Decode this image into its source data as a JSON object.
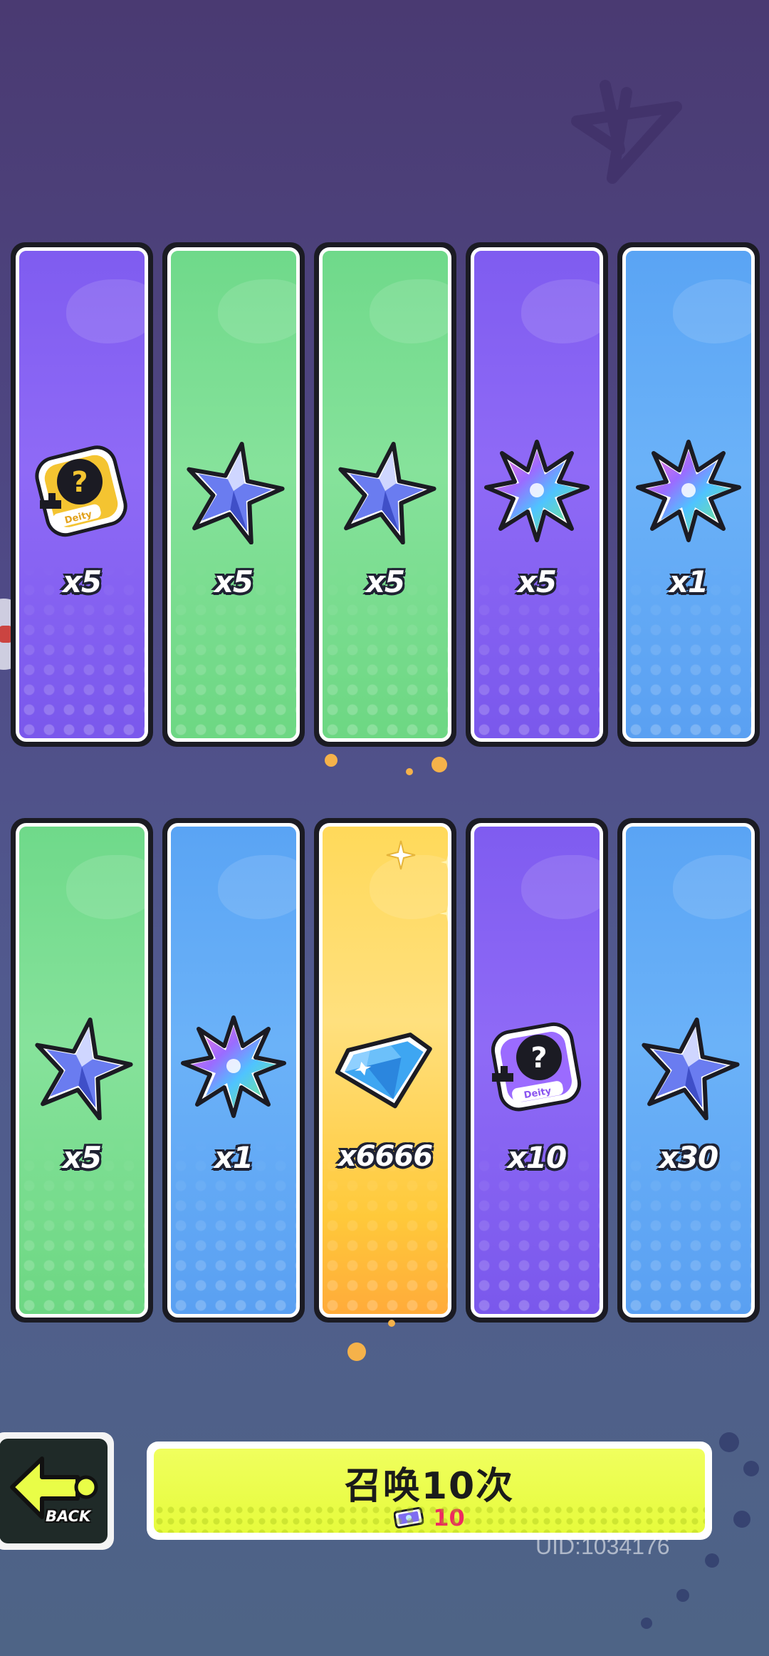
{
  "rows": [
    [
      {
        "theme": "purple",
        "icon": "deity-mystery-card-gold-icon",
        "qty": "x5"
      },
      {
        "theme": "green",
        "icon": "blue-star-shard-icon",
        "qty": "x5"
      },
      {
        "theme": "green",
        "icon": "blue-star-shard-icon",
        "qty": "x5"
      },
      {
        "theme": "purple",
        "icon": "rainbow-star-shard-icon",
        "qty": "x5"
      },
      {
        "theme": "blue",
        "icon": "rainbow-star-shard-icon",
        "qty": "x1"
      }
    ],
    [
      {
        "theme": "green",
        "icon": "blue-star-shard-icon",
        "qty": "x5"
      },
      {
        "theme": "blue",
        "icon": "rainbow-star-shard-icon",
        "qty": "x1"
      },
      {
        "theme": "gold",
        "icon": "blue-diamond-icon",
        "qty": "x6666"
      },
      {
        "theme": "purple",
        "icon": "deity-mystery-card-purple-icon",
        "qty": "x10"
      },
      {
        "theme": "blue",
        "icon": "blue-star-shard-icon",
        "qty": "x30"
      }
    ]
  ],
  "back_button": {
    "label": "BACK"
  },
  "summon_button": {
    "label": "召唤10次",
    "cost": "10",
    "cost_icon": "summon-ticket-icon"
  },
  "deity_badge": "Deity",
  "uid": "UID:1034176",
  "colors": {
    "purple": "#8466f3",
    "green": "#7ddd91",
    "blue": "#62abf6",
    "gold": "#ffdc6a",
    "summon_button": "#e9fd47",
    "cost_text": "#ee2a60"
  }
}
